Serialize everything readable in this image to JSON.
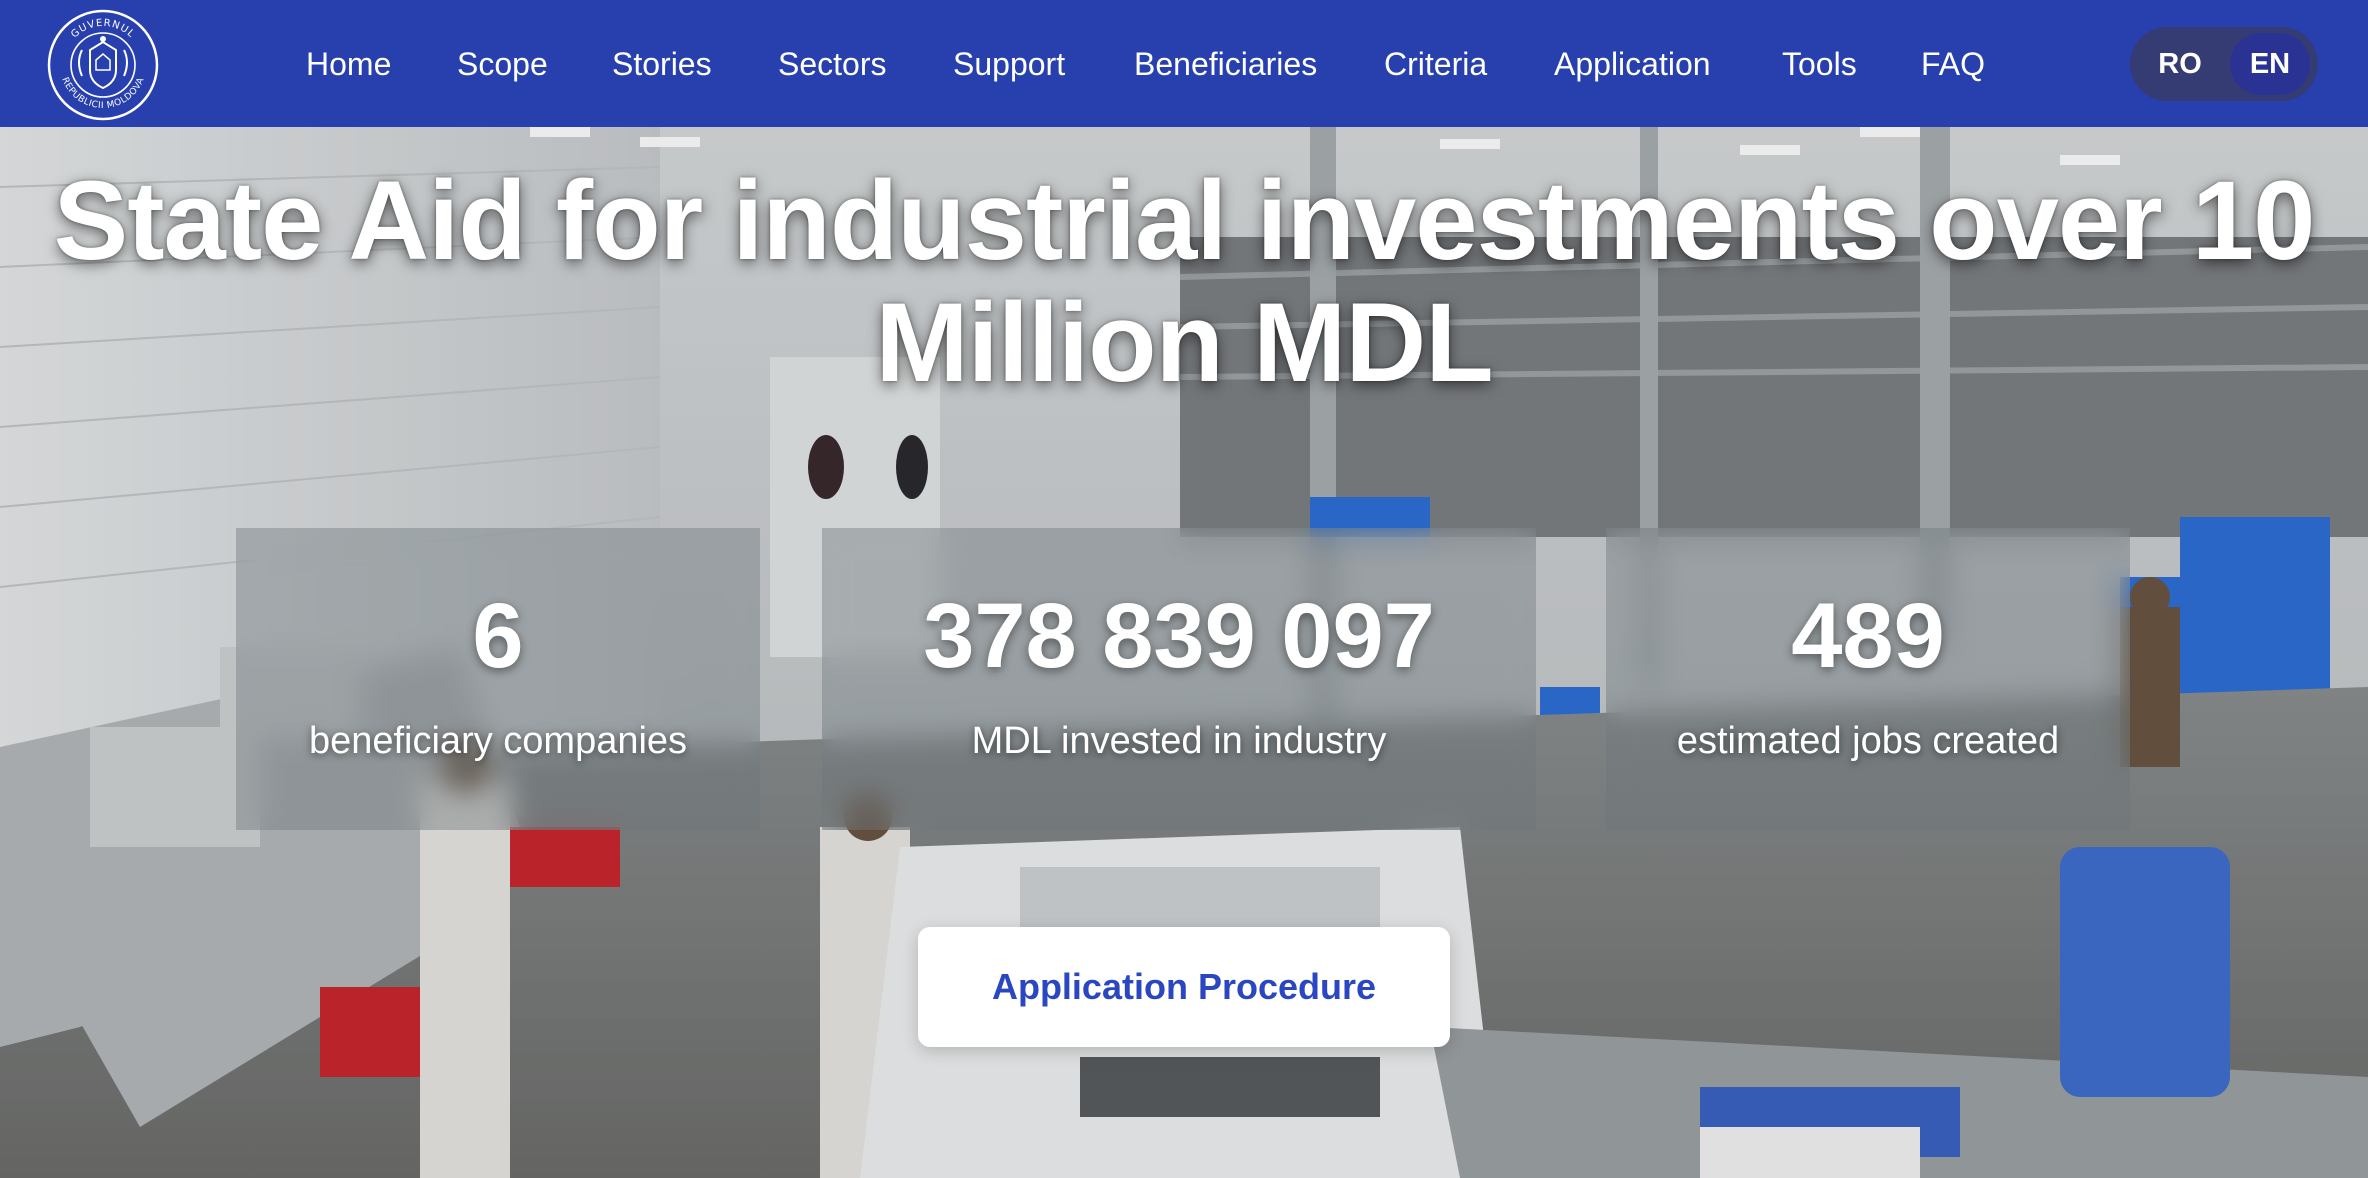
{
  "header": {
    "logo_text_top": "GUVERNUL",
    "logo_text_bottom": "REPUBLICII MOLDOVA",
    "nav": [
      {
        "label": "Home"
      },
      {
        "label": "Scope"
      },
      {
        "label": "Stories"
      },
      {
        "label": "Sectors"
      },
      {
        "label": "Support"
      },
      {
        "label": "Beneficiaries"
      },
      {
        "label": "Criteria"
      },
      {
        "label": "Application"
      },
      {
        "label": "Tools"
      },
      {
        "label": "FAQ"
      }
    ],
    "languages": [
      {
        "code": "RO",
        "active": false
      },
      {
        "code": "EN",
        "active": true
      }
    ]
  },
  "hero": {
    "title": "State Aid for industrial investments over 10 Million MDL",
    "stats": [
      {
        "value": "6",
        "label": "beneficiary companies"
      },
      {
        "value": "378 839 097",
        "label": "MDL invested in industry"
      },
      {
        "value": "489",
        "label": "estimated jobs created"
      }
    ],
    "cta_label": "Application Procedure"
  },
  "colors": {
    "header_bg": "#283fae",
    "lang_switch_bg": "#353b73",
    "cta_text": "#2a46c0",
    "cta_bg": "#ffffff"
  }
}
